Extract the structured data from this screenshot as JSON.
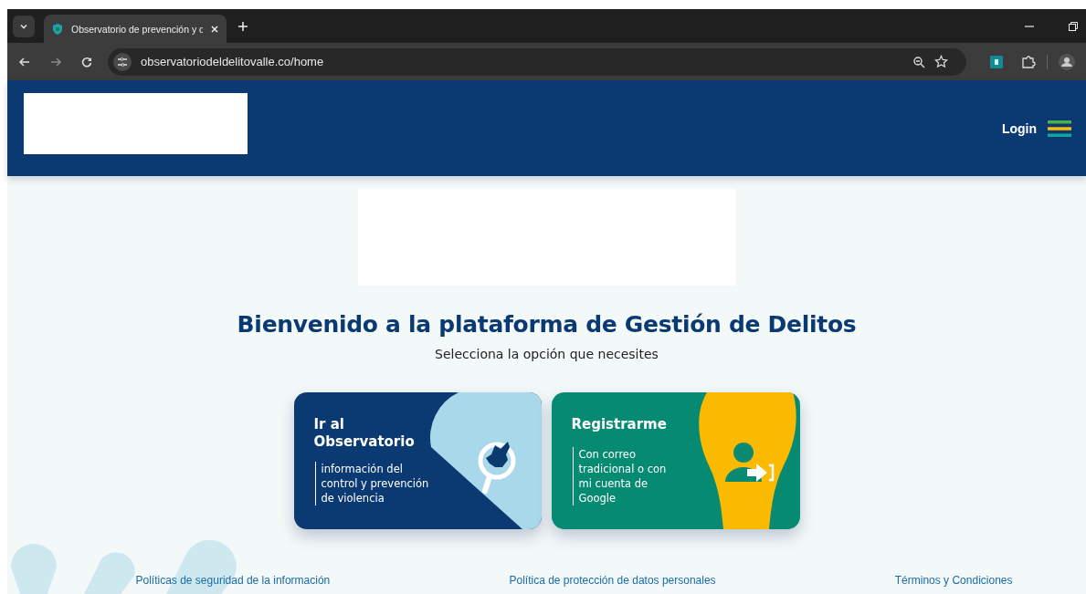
{
  "browser": {
    "tab_title": "Observatorio de prevención y c",
    "url": "observatoriodeldelitovalle.co/home"
  },
  "header": {
    "login": "Login"
  },
  "heading": "Bienvenido a la plataforma de Gestión de Delitos",
  "subtitle": "Selecciona la opción que necesites",
  "cards": [
    {
      "kind": "observatory",
      "title": "Ir al Observatorio",
      "description": "información del control y prevención de violencia"
    },
    {
      "kind": "register",
      "title": "Registrarme",
      "description": "Con correo tradicional o con mi cuenta de Google"
    }
  ],
  "footer_links": [
    "Políticas de seguridad de la información",
    "Política de protección de datos personales",
    "Términos y Condiciones"
  ]
}
